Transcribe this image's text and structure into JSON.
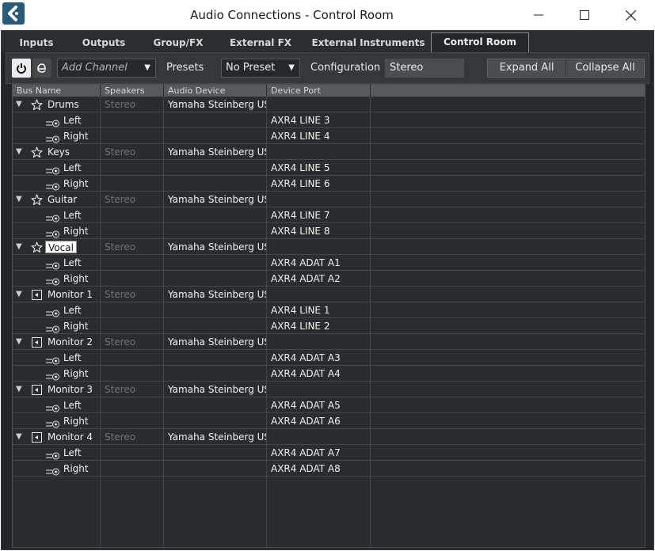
{
  "window": {
    "title": "Audio Connections - Control Room",
    "minimize_icon": "minimize-icon",
    "maximize_icon": "maximize-icon",
    "close_icon": "close-icon"
  },
  "tabs": [
    {
      "label": "Inputs",
      "active": false
    },
    {
      "label": "Outputs",
      "active": false
    },
    {
      "label": "Group/FX",
      "active": false
    },
    {
      "label": "External FX",
      "active": false
    },
    {
      "label": "External Instruments",
      "active": false
    },
    {
      "label": "Control Room",
      "active": true
    }
  ],
  "toolbar": {
    "add_channel_placeholder": "Add Channel",
    "presets_label": "Presets",
    "preset_value": "No Preset",
    "configuration_label": "Configuration",
    "configuration_value": "Stereo",
    "expand_all": "Expand All",
    "collapse_all": "Collapse All"
  },
  "columns": [
    "Bus Name",
    "Speakers",
    "Audio Device",
    "Device Port"
  ],
  "buses": [
    {
      "name": "Drums",
      "icon": "star-icon",
      "speakers": "Stereo",
      "device": "Yamaha Steinberg USB ASIO",
      "editing": false,
      "channels": [
        {
          "name": "Left",
          "port": "AXR4 LINE 3"
        },
        {
          "name": "Right",
          "port": "AXR4 LINE 4"
        }
      ]
    },
    {
      "name": "Keys",
      "icon": "star-icon",
      "speakers": "Stereo",
      "device": "Yamaha Steinberg USB ASIO",
      "editing": false,
      "channels": [
        {
          "name": "Left",
          "port": "AXR4 LINE 5"
        },
        {
          "name": "Right",
          "port": "AXR4 LINE 6"
        }
      ]
    },
    {
      "name": "Guitar",
      "icon": "star-icon",
      "speakers": "Stereo",
      "device": "Yamaha Steinberg USB ASIO",
      "editing": false,
      "channels": [
        {
          "name": "Left",
          "port": "AXR4 LINE 7"
        },
        {
          "name": "Right",
          "port": "AXR4 LINE 8"
        }
      ]
    },
    {
      "name": "Vocal",
      "icon": "star-icon",
      "speakers": "Stereo",
      "device": "Yamaha Steinberg USB ASIO",
      "editing": true,
      "channels": [
        {
          "name": "Left",
          "port": "AXR4 ADAT A1"
        },
        {
          "name": "Right",
          "port": "AXR4 ADAT A2"
        }
      ]
    },
    {
      "name": "Monitor 1",
      "icon": "speaker-icon",
      "speakers": "Stereo",
      "device": "Yamaha Steinberg USB ASIO",
      "editing": false,
      "channels": [
        {
          "name": "Left",
          "port": "AXR4 LINE 1"
        },
        {
          "name": "Right",
          "port": "AXR4 LINE 2"
        }
      ]
    },
    {
      "name": "Monitor 2",
      "icon": "speaker-icon",
      "speakers": "Stereo",
      "device": "Yamaha Steinberg USB ASIO",
      "editing": false,
      "channels": [
        {
          "name": "Left",
          "port": "AXR4 ADAT A3"
        },
        {
          "name": "Right",
          "port": "AXR4 ADAT A4"
        }
      ]
    },
    {
      "name": "Monitor 3",
      "icon": "speaker-icon",
      "speakers": "Stereo",
      "device": "Yamaha Steinberg USB ASIO",
      "editing": false,
      "channels": [
        {
          "name": "Left",
          "port": "AXR4 ADAT A5"
        },
        {
          "name": "Right",
          "port": "AXR4 ADAT A6"
        }
      ]
    },
    {
      "name": "Monitor 4",
      "icon": "speaker-icon",
      "speakers": "Stereo",
      "device": "Yamaha Steinberg USB ASIO",
      "editing": false,
      "channels": [
        {
          "name": "Left",
          "port": "AXR4 ADAT A7"
        },
        {
          "name": "Right",
          "port": "AXR4 ADAT A8"
        }
      ]
    }
  ]
}
